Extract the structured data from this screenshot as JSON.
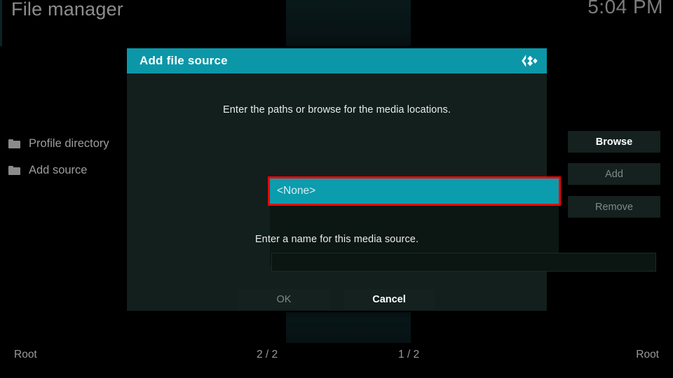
{
  "window": {
    "title": "File manager",
    "clock": "5:04 PM"
  },
  "colors": {
    "accent_teal": "#0b97a8",
    "selection_teal": "#0b9cae",
    "annotation_red": "#ff0000",
    "dialog_background": "#121f1c",
    "app_background": "#000000"
  },
  "sidebar": {
    "items": [
      {
        "icon": "folder-icon",
        "label": "Profile directory"
      },
      {
        "icon": "folder-icon",
        "label": "Add source"
      }
    ]
  },
  "status_bar": {
    "left_path": "Root",
    "left_page": "2 / 2",
    "right_page": "1 / 2",
    "right_path": "Root"
  },
  "dialog": {
    "title": "Add file source",
    "logo_icon": "kodi-logo-icon",
    "paths_help_text": "Enter the paths or browse for the media locations.",
    "paths": [
      {
        "label": "<None>",
        "selected": true,
        "annotated": true
      }
    ],
    "side_buttons": [
      {
        "label": "Browse",
        "enabled": true
      },
      {
        "label": "Add",
        "enabled": false
      },
      {
        "label": "Remove",
        "enabled": false
      }
    ],
    "name_help_text": "Enter a name for this media source.",
    "name_input": {
      "value": "",
      "placeholder": ""
    },
    "action_buttons": [
      {
        "label": "OK",
        "enabled": false
      },
      {
        "label": "Cancel",
        "enabled": true
      }
    ]
  }
}
